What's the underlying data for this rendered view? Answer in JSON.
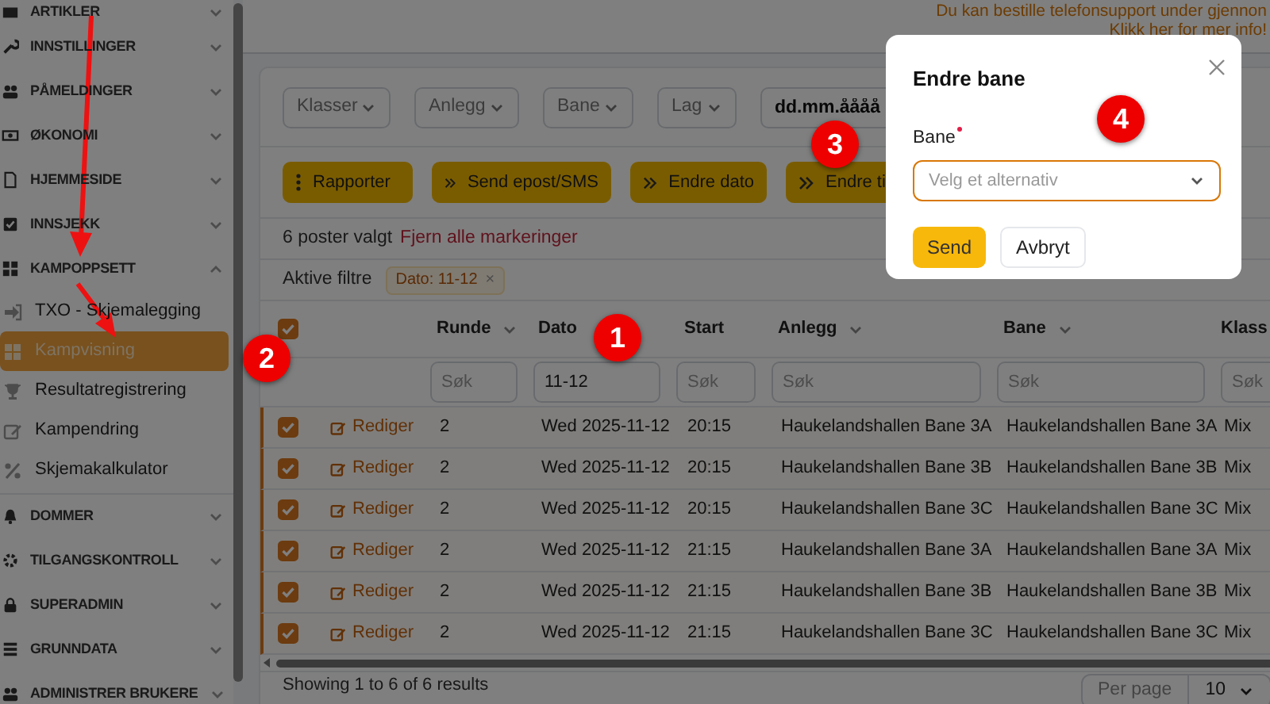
{
  "header_notice": [
    "Du kan bestille telefonsupport under gjennon",
    "Klikk her for mer info!"
  ],
  "sidebar": {
    "items": [
      {
        "label": "ARTIKLER",
        "expanded": false
      },
      {
        "label": "INNSTILLINGER",
        "expanded": false
      },
      {
        "label": "PÅMELDINGER",
        "expanded": false
      },
      {
        "label": "ØKONOMI",
        "expanded": false
      },
      {
        "label": "HJEMMESIDE",
        "expanded": false
      },
      {
        "label": "INNSJEKK",
        "expanded": false
      },
      {
        "label": "KAMPOPPSETT",
        "expanded": true,
        "children": [
          {
            "label": "TXO - Skjemalegging",
            "selected": false
          },
          {
            "label": "Kampvisning",
            "selected": true
          },
          {
            "label": "Resultatregistrering",
            "selected": false
          },
          {
            "label": "Kampendring",
            "selected": false
          },
          {
            "label": "Skjemakalkulator",
            "selected": false
          }
        ]
      },
      {
        "label": "DOMMER",
        "expanded": false
      },
      {
        "label": "TILGANGSKONTROLL",
        "expanded": false
      },
      {
        "label": "SUPERADMIN",
        "expanded": false
      },
      {
        "label": "GRUNNDATA",
        "expanded": false
      },
      {
        "label": "ADMINISTRER BRUKERE",
        "expanded": false
      }
    ]
  },
  "filters": [
    {
      "label": "Klasser"
    },
    {
      "label": "Anlegg"
    },
    {
      "label": "Bane"
    },
    {
      "label": "Lag"
    }
  ],
  "date_field": {
    "placeholder": "dd.mm.åååå"
  },
  "actions": [
    {
      "label": "Rapporter",
      "kind": "menu"
    },
    {
      "label": "Send epost/SMS",
      "kind": "bulk"
    },
    {
      "label": "Endre dato",
      "kind": "bulk"
    },
    {
      "label": "Endre ti",
      "kind": "bulk"
    }
  ],
  "selection": {
    "count": "6 poster valgt",
    "clear_link": "Fjern alle markeringer"
  },
  "active_filters": {
    "label": "Aktive filtre",
    "chips": [
      {
        "label": "Dato: 11-12",
        "remove": "×"
      }
    ]
  },
  "table": {
    "select_all": {
      "checked": true
    },
    "columns": [
      {
        "label": "Runde",
        "dropdown": true
      },
      {
        "label": "Dato",
        "dropdown": false
      },
      {
        "label": "Start",
        "dropdown": false
      },
      {
        "label": "Anlegg",
        "dropdown": true
      },
      {
        "label": "Bane",
        "dropdown": true
      },
      {
        "label": "Klass",
        "dropdown": false
      }
    ],
    "column_filters": [
      {
        "placeholder": "Søk"
      },
      {
        "value": "11-12"
      },
      {
        "placeholder": "Søk"
      },
      {
        "placeholder": "Søk"
      },
      {
        "placeholder": "Søk"
      },
      {
        "placeholder": "Søk"
      }
    ],
    "rows": [
      {
        "checked": true,
        "edit": "Rediger",
        "cells": [
          "2",
          "Wed 2025-11-12",
          "20:15",
          "Haukelandshallen Bane 3A",
          "Haukelandshallen Bane 3A",
          "Mix"
        ]
      },
      {
        "checked": true,
        "edit": "Rediger",
        "cells": [
          "2",
          "Wed 2025-11-12",
          "20:15",
          "Haukelandshallen Bane 3B",
          "Haukelandshallen Bane 3B",
          "Mix"
        ]
      },
      {
        "checked": true,
        "edit": "Rediger",
        "cells": [
          "2",
          "Wed 2025-11-12",
          "20:15",
          "Haukelandshallen Bane 3C",
          "Haukelandshallen Bane 3C",
          "Mix"
        ]
      },
      {
        "checked": true,
        "edit": "Rediger",
        "cells": [
          "2",
          "Wed 2025-11-12",
          "21:15",
          "Haukelandshallen Bane 3A",
          "Haukelandshallen Bane 3A",
          "Mix"
        ]
      },
      {
        "checked": true,
        "edit": "Rediger",
        "cells": [
          "2",
          "Wed 2025-11-12",
          "21:15",
          "Haukelandshallen Bane 3B",
          "Haukelandshallen Bane 3B",
          "Mix"
        ]
      },
      {
        "checked": true,
        "edit": "Rediger",
        "cells": [
          "2",
          "Wed 2025-11-12",
          "21:15",
          "Haukelandshallen Bane 3C",
          "Haukelandshallen Bane 3C",
          "Mix"
        ]
      }
    ]
  },
  "footer": {
    "summary": "Showing 1 to 6 of 6 results",
    "per_page_label": "Per page",
    "per_page_value": "10"
  },
  "modal": {
    "title": "Endre bane",
    "field_label": "Bane",
    "required": true,
    "select_placeholder": "Velg et alternativ",
    "buttons": [
      {
        "label": "Send",
        "kind": "primary"
      },
      {
        "label": "Avbryt",
        "kind": "secondary"
      }
    ]
  },
  "annotations": [
    {
      "label": "1"
    },
    {
      "label": "2"
    },
    {
      "label": "3"
    },
    {
      "label": "4"
    }
  ]
}
